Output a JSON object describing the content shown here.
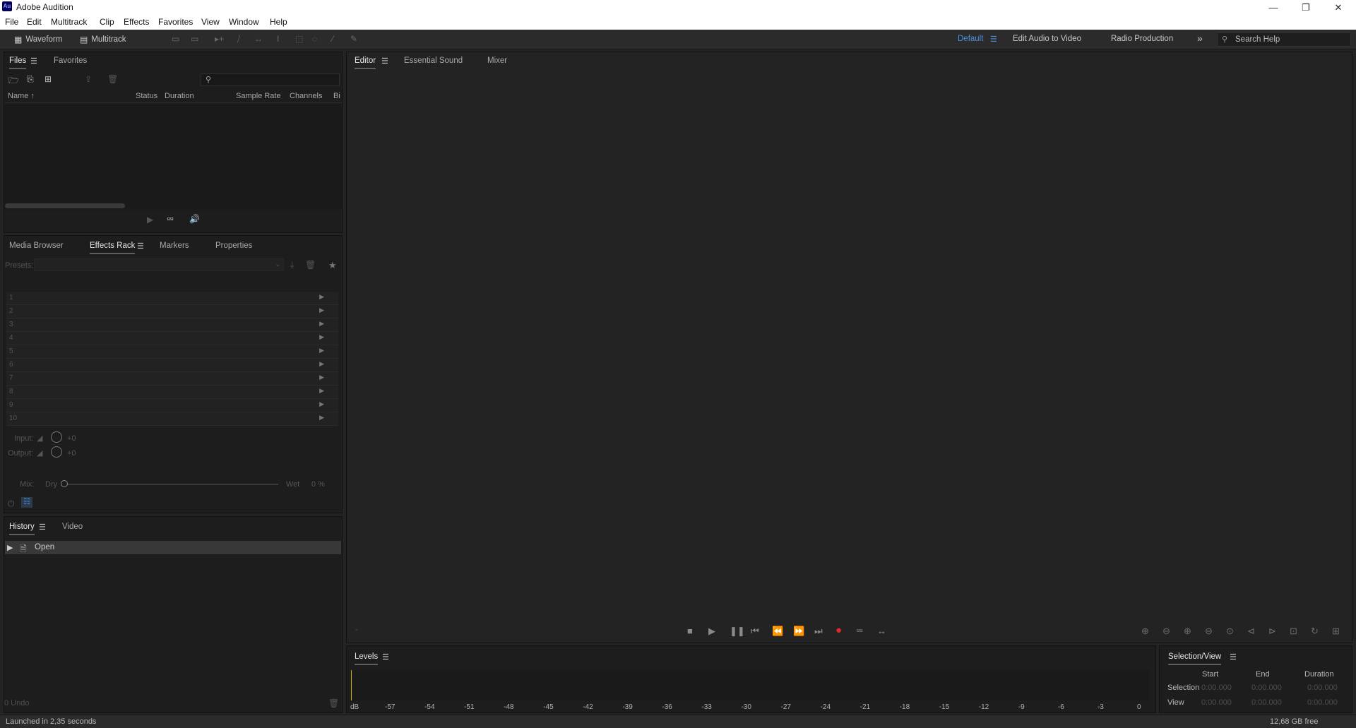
{
  "app": {
    "title": "Adobe Audition",
    "logo_text": "Au"
  },
  "window_controls": {
    "minimize": "—",
    "restore": "❐",
    "close": "✕"
  },
  "menu": [
    "File",
    "Edit",
    "Multitrack",
    "Clip",
    "Effects",
    "Favorites",
    "View",
    "Window",
    "Help"
  ],
  "toolbar": {
    "waveform_label": "Waveform",
    "multitrack_label": "Multitrack",
    "workspaces": [
      "Default",
      "Edit Audio to Video",
      "Radio Production"
    ],
    "more_label": "»",
    "search_placeholder": "Search Help"
  },
  "files_panel": {
    "tabs": [
      "Files",
      "Favorites"
    ],
    "columns": [
      "Name",
      "Status",
      "Duration",
      "Sample Rate",
      "Channels",
      "Bi"
    ],
    "search_placeholder": ""
  },
  "effects_panel": {
    "tabs": [
      "Media Browser",
      "Effects Rack",
      "Markers",
      "Properties"
    ],
    "presets_label": "Presets:",
    "rack_slots": [
      "1",
      "2",
      "3",
      "4",
      "5",
      "6",
      "7",
      "8",
      "9",
      "10"
    ],
    "input_label": "Input:",
    "input_value": "+0",
    "output_label": "Output:",
    "output_value": "+0",
    "mix_label": "Mix:",
    "dry_label": "Dry",
    "wet_label": "Wet",
    "wet_value": "0 %"
  },
  "history_panel": {
    "tabs": [
      "History",
      "Video"
    ],
    "items": [
      "Open"
    ],
    "undo_count": "0 Undo"
  },
  "editor": {
    "tabs": [
      "Editor",
      "Essential Sound",
      "Mixer"
    ],
    "time_display": "-"
  },
  "levels": {
    "title": "Levels",
    "unit": "dB",
    "ticks": [
      "-57",
      "-54",
      "-51",
      "-48",
      "-45",
      "-42",
      "-39",
      "-36",
      "-33",
      "-30",
      "-27",
      "-24",
      "-21",
      "-18",
      "-15",
      "-12",
      "-9",
      "-6",
      "-3",
      "0"
    ]
  },
  "selection_view": {
    "title": "Selection/View",
    "headers": [
      "Start",
      "End",
      "Duration"
    ],
    "rows": [
      {
        "label": "Selection",
        "start": "0:00.000",
        "end": "0:00.000",
        "duration": "0:00.000"
      },
      {
        "label": "View",
        "start": "0:00.000",
        "end": "0:00.000",
        "duration": "0:00.000"
      }
    ]
  },
  "status": {
    "left": "Launched in 2,35 seconds",
    "right": "12,68 GB free"
  },
  "colors": {
    "accent_blue": "#4a90e2",
    "record_red": "#e02a2a"
  }
}
